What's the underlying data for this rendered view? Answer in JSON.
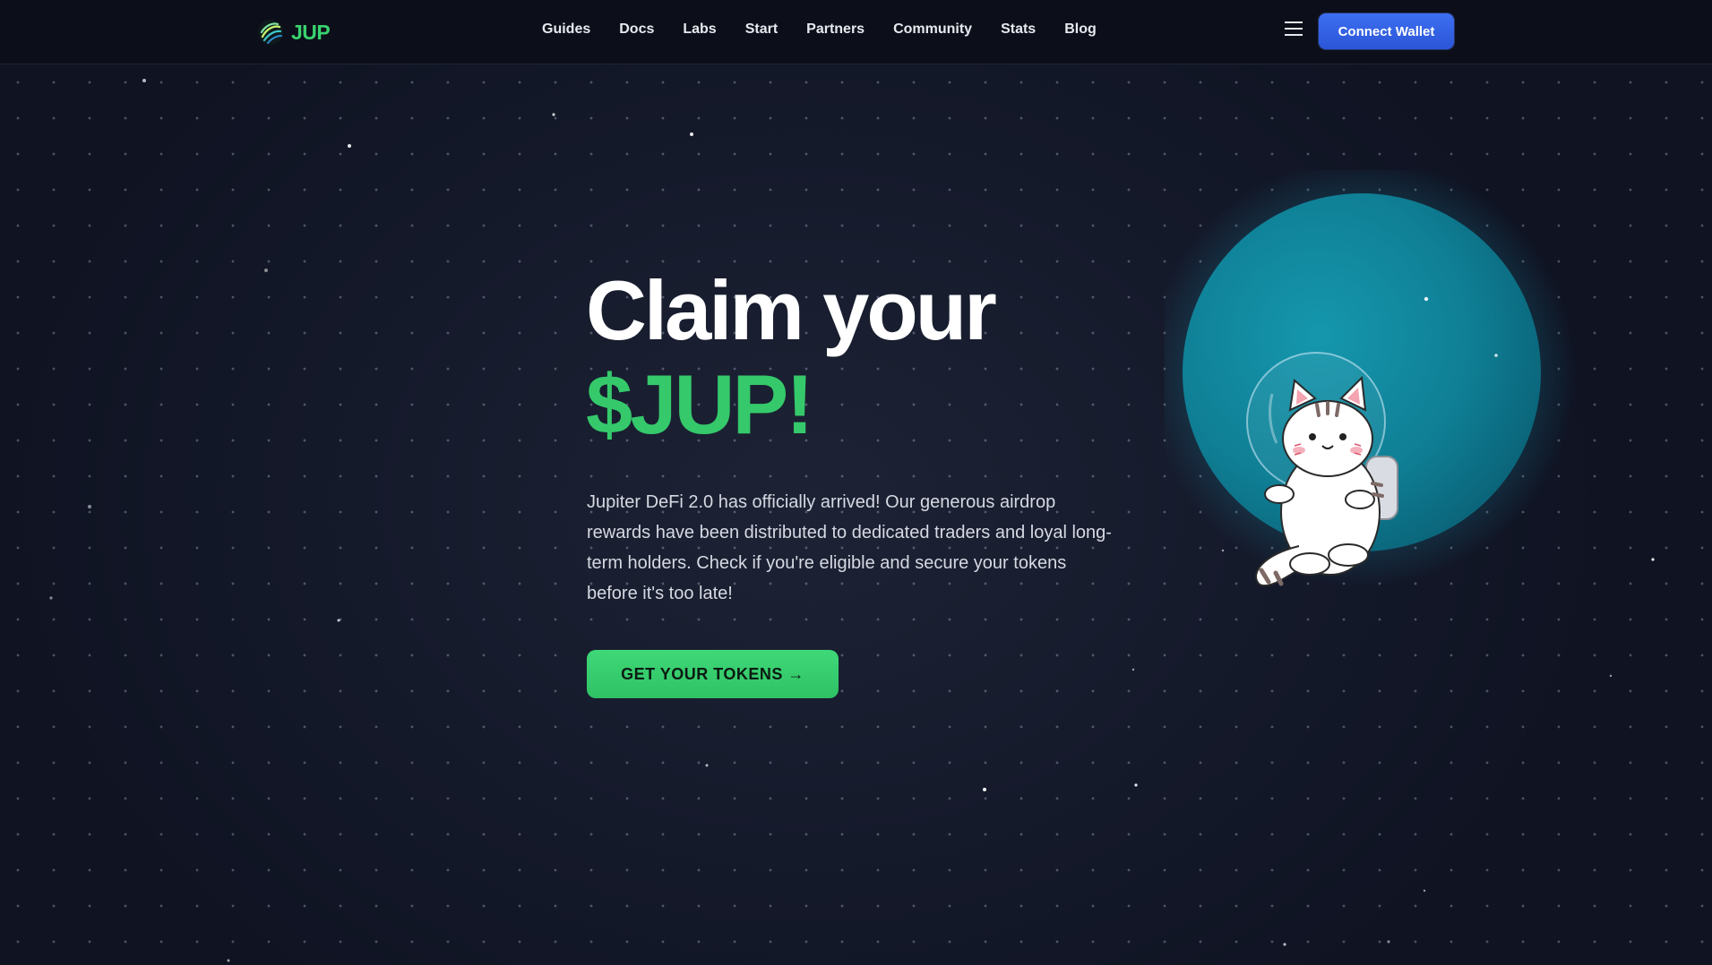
{
  "nav": {
    "brand": "JUP",
    "links": [
      "Guides",
      "Docs",
      "Labs",
      "Start",
      "Partners",
      "Community",
      "Stats",
      "Blog"
    ],
    "menu_icon": "hamburger-icon",
    "connect_label": "Connect Wallet"
  },
  "hero": {
    "title_line1": "Claim your",
    "title_line2": "$JUP!",
    "description": "Jupiter DeFi 2.0 has officially arrived! Our generous airdrop rewards have been distributed to dedicated traders and loyal long-term holders. Check if you're eligible and secure your tokens before it's too late!",
    "cta_label": "GET YOUR TOKENS →",
    "illustration": "astronaut-cat-on-planet"
  },
  "colors": {
    "brand_green": "#35c96b",
    "button_blue": "#2b55d6",
    "background": "#151a2b",
    "planet": "#0e7f96"
  }
}
